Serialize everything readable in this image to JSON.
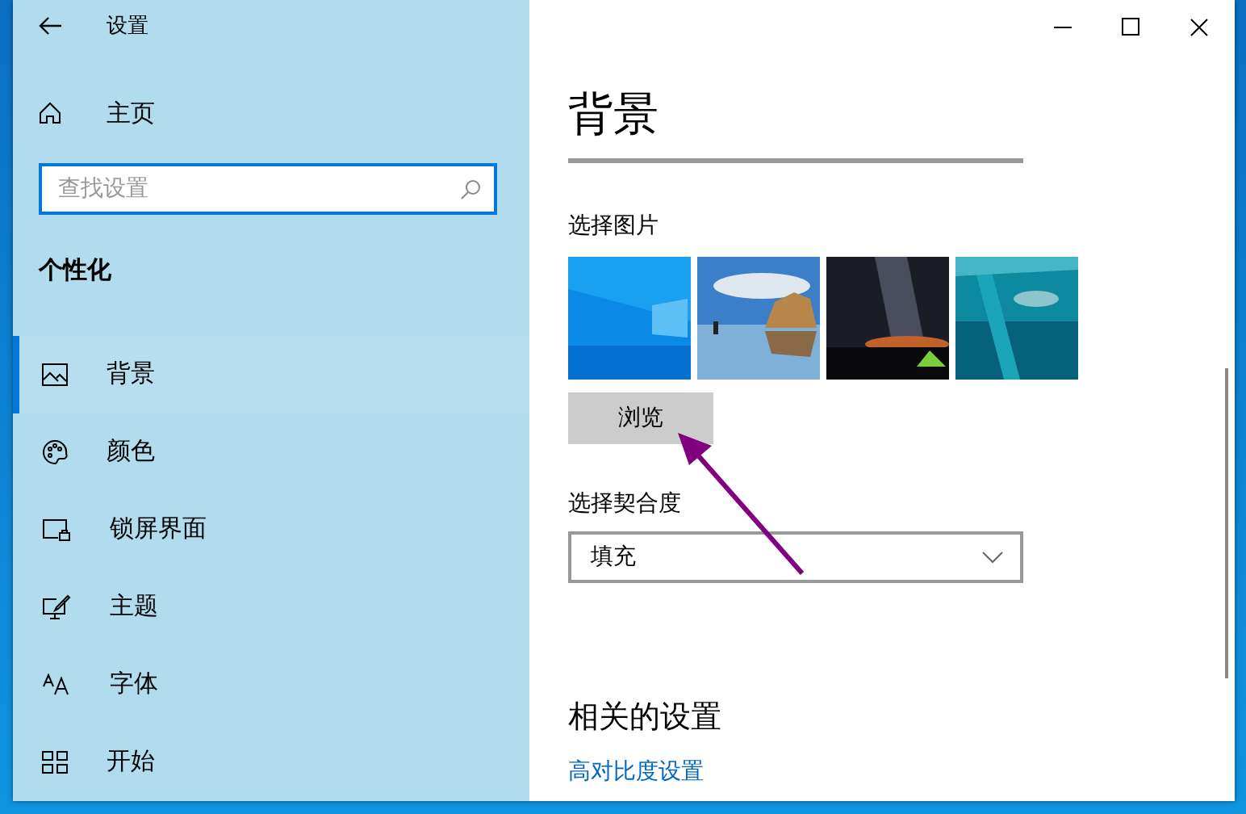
{
  "window": {
    "title": "设置"
  },
  "sidebar": {
    "home": "主页",
    "search": {
      "placeholder": "查找设置"
    },
    "section": "个性化",
    "items": [
      {
        "label": "背景",
        "selected": true
      },
      {
        "label": "颜色",
        "selected": false
      },
      {
        "label": "锁屏界面",
        "selected": false
      },
      {
        "label": "主题",
        "selected": false
      },
      {
        "label": "字体",
        "selected": false
      },
      {
        "label": "开始",
        "selected": false
      }
    ]
  },
  "content": {
    "title": "背景",
    "picture_label": "选择图片",
    "browse_button": "浏览",
    "fit_label": "选择契合度",
    "fit_value": "填充",
    "related_title": "相关的设置",
    "related_link": "高对比度设置"
  }
}
